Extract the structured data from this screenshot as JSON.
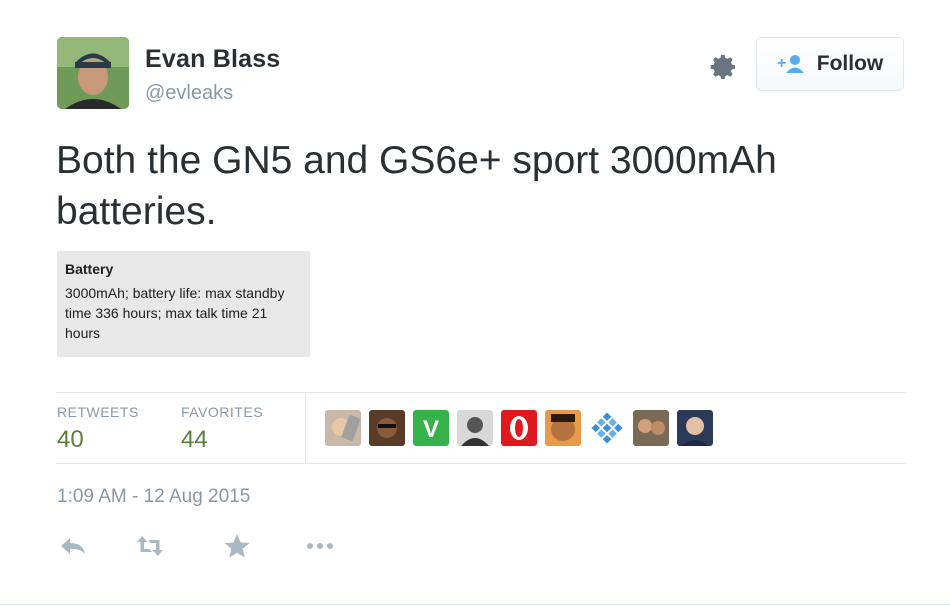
{
  "header": {
    "name": "Evan Blass",
    "handle": "@evleaks",
    "follow_label": "Follow"
  },
  "tweet": {
    "text": "Both the GN5 and GS6e+ sport 3000mAh batteries."
  },
  "media_card": {
    "title": "Battery",
    "body": "3000mAh; battery life: max standby time 336 hours; max talk time 21 hours"
  },
  "stats": {
    "retweets_label": "RETWEETS",
    "retweets_value": "40",
    "favorites_label": "FAVORITES",
    "favorites_value": "44"
  },
  "favoriters": [
    {
      "icon": "user-avatar"
    },
    {
      "icon": "user-avatar"
    },
    {
      "icon": "vine-style-avatar",
      "letter": "V"
    },
    {
      "icon": "user-avatar"
    },
    {
      "icon": "opera-style-avatar"
    },
    {
      "icon": "user-avatar"
    },
    {
      "icon": "tile-grid-avatar"
    },
    {
      "icon": "user-avatar"
    },
    {
      "icon": "user-avatar"
    }
  ],
  "timestamp": "1:09 AM - 12 Aug 2015",
  "actions": [
    "reply-icon",
    "retweet-icon",
    "favorite-star-icon",
    "more-icon"
  ],
  "colors": {
    "stat_value": "#5b7f3a",
    "muted": "#8899a6",
    "text": "#292f33",
    "follow_icon": "#55acee"
  }
}
